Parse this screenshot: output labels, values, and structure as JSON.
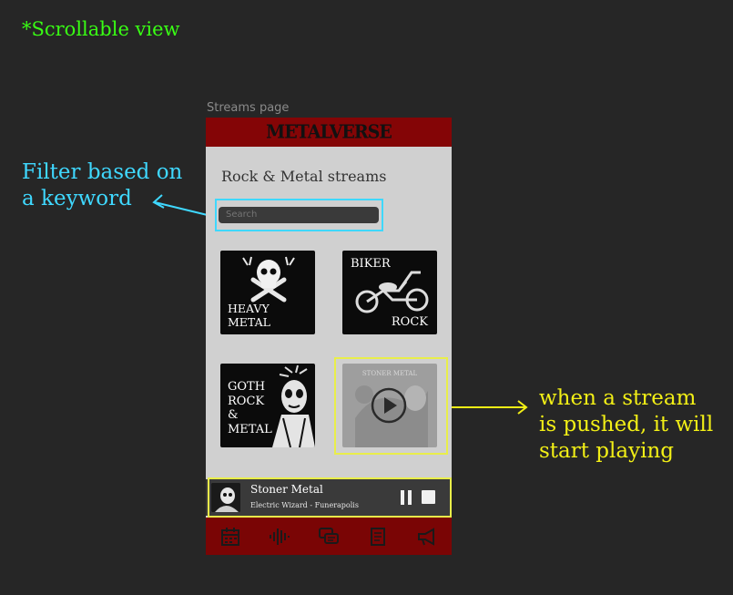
{
  "scroll_note": "*Scrollable view",
  "annotations": {
    "filter_line1": "Filter based on",
    "filter_line2": "a keyword",
    "play_line1": "when a stream",
    "play_line2": "is pushed, it will",
    "play_line3": "start playing"
  },
  "frame_label": "Streams page",
  "header": {
    "logo": "METALVERSE"
  },
  "page_heading": "Rock & Metal streams",
  "search": {
    "placeholder": "Search"
  },
  "tiles": [
    {
      "label": "HEAVY METAL",
      "icon": "skull-crossbones-icon"
    },
    {
      "label_top": "BIKER",
      "label_bottom": "ROCK",
      "icon": "motorcycle-icon"
    },
    {
      "label": "GOTH\nROCK\n&\nMETAL",
      "icon": "goth-figure-icon"
    },
    {
      "label": "STONER METAL",
      "icon": "play-icon"
    }
  ],
  "player": {
    "title": "Stoner Metal",
    "subtitle": "Electric Wizard - Funerapolis"
  },
  "nav": [
    "calendar-icon",
    "audio-wave-icon",
    "chat-icon",
    "document-icon",
    "megaphone-icon"
  ],
  "colors": {
    "background": "#262626",
    "header": "#840506",
    "navbar": "#7a0505",
    "highlight_cyan": "#3fd8ff",
    "highlight_yellow": "#e9ee4a",
    "note_green": "#39ff14"
  }
}
